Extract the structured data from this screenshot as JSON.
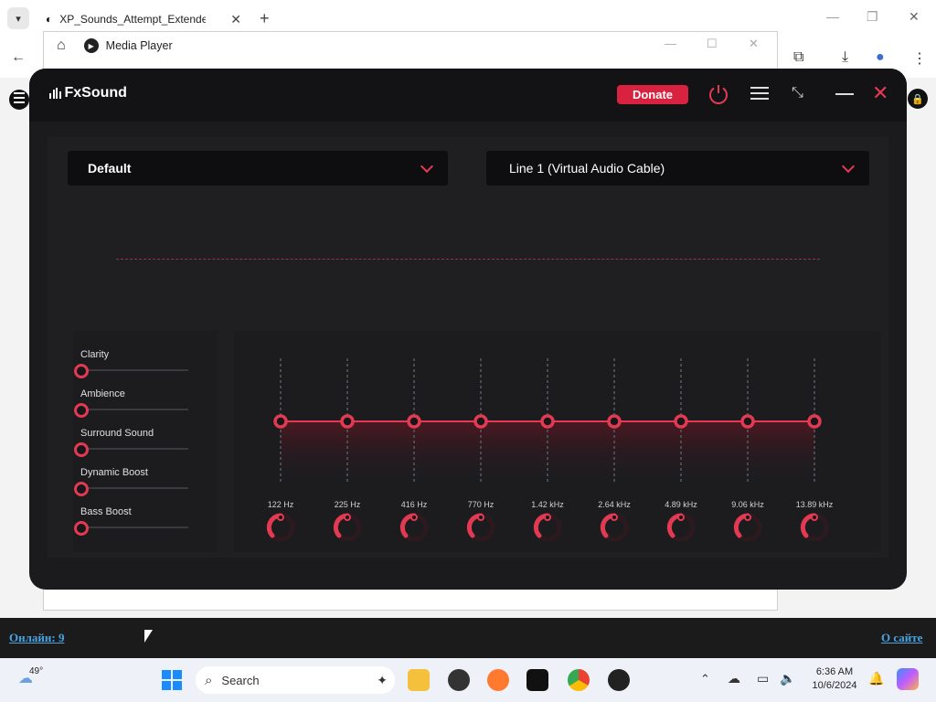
{
  "browser": {
    "tab_title": "XP_Sounds_Attempt_Extended_",
    "new_tab": "+",
    "close_tab": "✕"
  },
  "inner_window": {
    "title": "Media Player"
  },
  "fxsound": {
    "app_name": "FxSound",
    "donate_label": "Donate",
    "preset": "Default",
    "output_device": "Line 1 (Virtual Audio Cable)",
    "effects": [
      {
        "label": "Clarity",
        "value": 0
      },
      {
        "label": "Ambience",
        "value": 0
      },
      {
        "label": "Surround Sound",
        "value": 0
      },
      {
        "label": "Dynamic Boost",
        "value": 0
      },
      {
        "label": "Bass Boost",
        "value": 0
      }
    ],
    "eq_bands": [
      {
        "freq": "122 Hz",
        "gain": 0
      },
      {
        "freq": "225 Hz",
        "gain": 0
      },
      {
        "freq": "416 Hz",
        "gain": 0
      },
      {
        "freq": "770 Hz",
        "gain": 0
      },
      {
        "freq": "1.42 kHz",
        "gain": 0
      },
      {
        "freq": "2.64 kHz",
        "gain": 0
      },
      {
        "freq": "4.89 kHz",
        "gain": 0
      },
      {
        "freq": "9.06 kHz",
        "gain": 0
      },
      {
        "freq": "13.89 kHz",
        "gain": 0
      }
    ],
    "accent_color": "#e23a52"
  },
  "footer": {
    "online_label": "Онлайн: 9",
    "about_label": "О сайте"
  },
  "taskbar": {
    "weather_temp": "49°",
    "search_placeholder": "Search",
    "time": "6:36 AM",
    "date": "10/6/2024"
  }
}
